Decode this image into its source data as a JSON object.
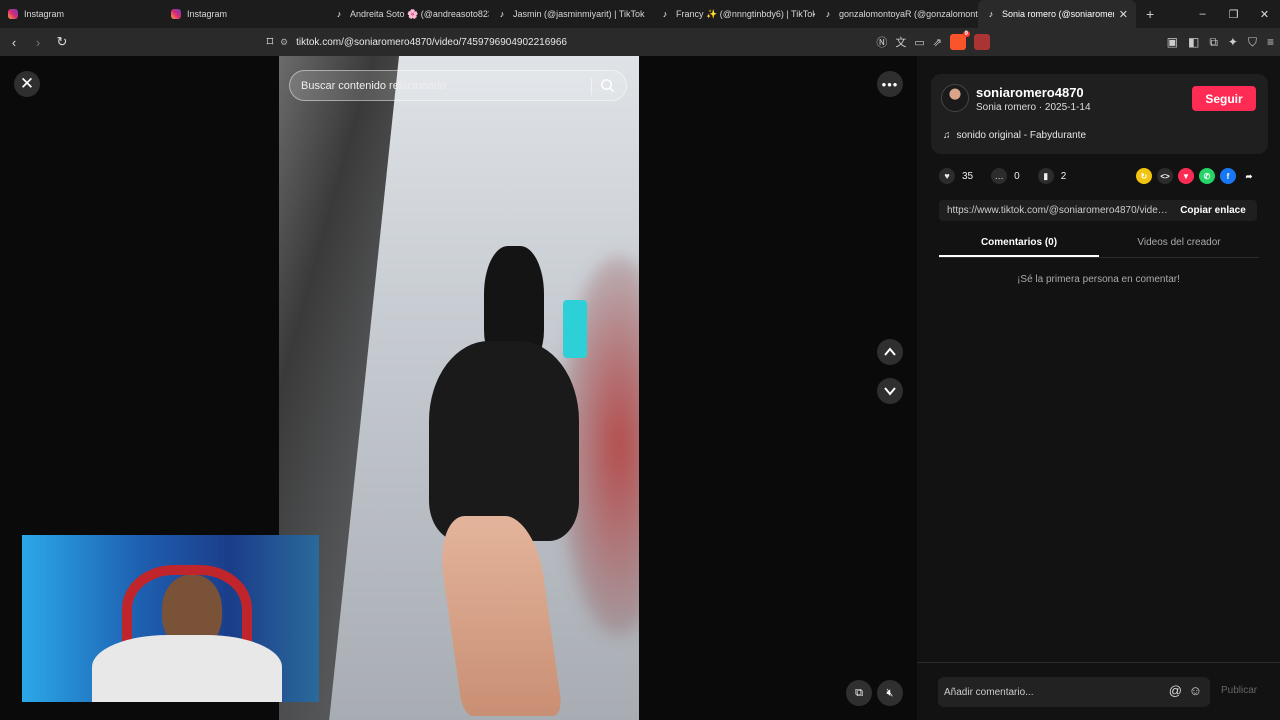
{
  "browser": {
    "tabs": [
      {
        "label": "Instagram",
        "icon": "instagram-icon"
      },
      {
        "label": "Instagram",
        "icon": "instagram-icon"
      },
      {
        "label": "Andreita Soto 🌸 (@andreasoto823",
        "icon": "tiktok-icon"
      },
      {
        "label": "Jasmin (@jasminmiyarit) | TikTok",
        "icon": "tiktok-icon"
      },
      {
        "label": "Francy ✨ (@nnngtinbdy6) | TikTok",
        "icon": "tiktok-icon"
      },
      {
        "label": "gonzalomontoyaR (@gonzalomonto",
        "icon": "tiktok-icon"
      },
      {
        "label": "Sonia romero (@soniaromero48",
        "icon": "tiktok-icon",
        "active": true
      }
    ],
    "new_tab": "+",
    "window_controls": {
      "minimize": "–",
      "restore": "❐",
      "close": "✕"
    },
    "url": "tiktok.com/@soniaromero4870/video/7459796904902216966",
    "brave_badge": "9"
  },
  "video": {
    "search_placeholder": "Buscar contenido relacionado",
    "close": "✕",
    "more": "•••"
  },
  "panel": {
    "username": "soniaromero4870",
    "subtitle": "Sonia romero · 2025-1-14",
    "follow_label": "Seguir",
    "music": "sonido original - Fabydurante",
    "likes": "35",
    "comments": "0",
    "saves": "2",
    "link": "https://www.tiktok.com/@soniaromero4870/video...",
    "copy_label": "Copiar enlace",
    "tab_comments": "Comentarios (0)",
    "tab_videos": "Videos del creador",
    "empty_text": "¡Sé la primera persona en comentar!",
    "comment_placeholder": "Añadir comentario...",
    "publish_label": "Publicar",
    "accent": "#fe2c55"
  }
}
